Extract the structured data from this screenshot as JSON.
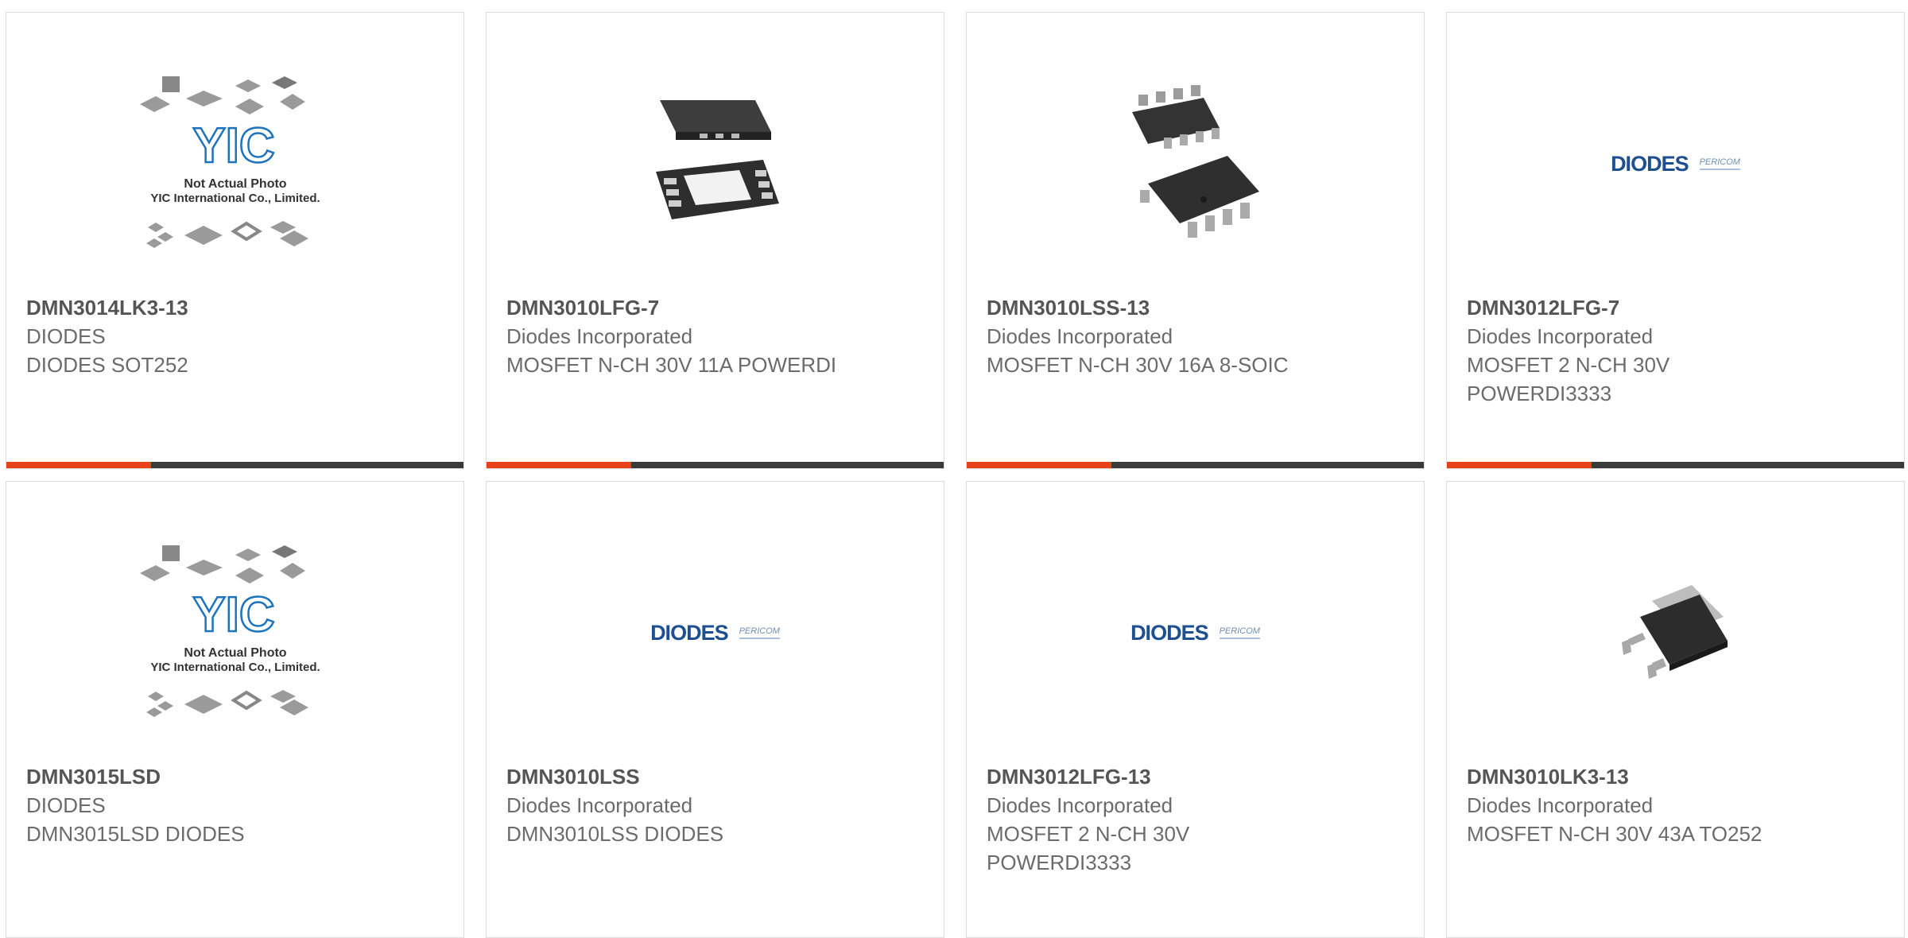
{
  "colors": {
    "accent": "#e8421a",
    "bar": "#3a3a3a",
    "border": "#dcdcdc"
  },
  "products": [
    {
      "part_number": "DMN3014LK3-13",
      "manufacturer": "DIODES",
      "description": "DIODES SOT252",
      "image": "yic-placeholder",
      "caption_line1": "Not Actual Photo",
      "caption_line2": "YIC International Co., Limited.",
      "logo_text": "YIC"
    },
    {
      "part_number": "DMN3010LFG-7",
      "manufacturer": "Diodes Incorporated",
      "description": "MOSFET N-CH 30V 11A POWERDI",
      "image": "qfn-chip"
    },
    {
      "part_number": "DMN3010LSS-13",
      "manufacturer": "Diodes Incorporated",
      "description": "MOSFET N-CH 30V 16A 8-SOIC",
      "image": "soic-chip"
    },
    {
      "part_number": "DMN3012LFG-7",
      "manufacturer": "Diodes Incorporated",
      "description": "MOSFET 2 N-CH 30V POWERDI3333",
      "image": "diodes-logo",
      "logo_main": "DIODES",
      "logo_secondary": "PERICOM"
    },
    {
      "part_number": "DMN3015LSD",
      "manufacturer": "DIODES",
      "description": "DMN3015LSD DIODES",
      "image": "yic-placeholder",
      "caption_line1": "Not Actual Photo",
      "caption_line2": "YIC International Co., Limited.",
      "logo_text": "YIC"
    },
    {
      "part_number": "DMN3010LSS",
      "manufacturer": "Diodes Incorporated",
      "description": "DMN3010LSS DIODES",
      "image": "diodes-logo",
      "logo_main": "DIODES",
      "logo_secondary": "PERICOM"
    },
    {
      "part_number": "DMN3012LFG-13",
      "manufacturer": "Diodes Incorporated",
      "description": "MOSFET 2 N-CH 30V POWERDI3333",
      "image": "diodes-logo",
      "logo_main": "DIODES",
      "logo_secondary": "PERICOM"
    },
    {
      "part_number": "DMN3010LK3-13",
      "manufacturer": "Diodes Incorporated",
      "description": "MOSFET N-CH 30V 43A TO252",
      "image": "to252-chip"
    }
  ]
}
